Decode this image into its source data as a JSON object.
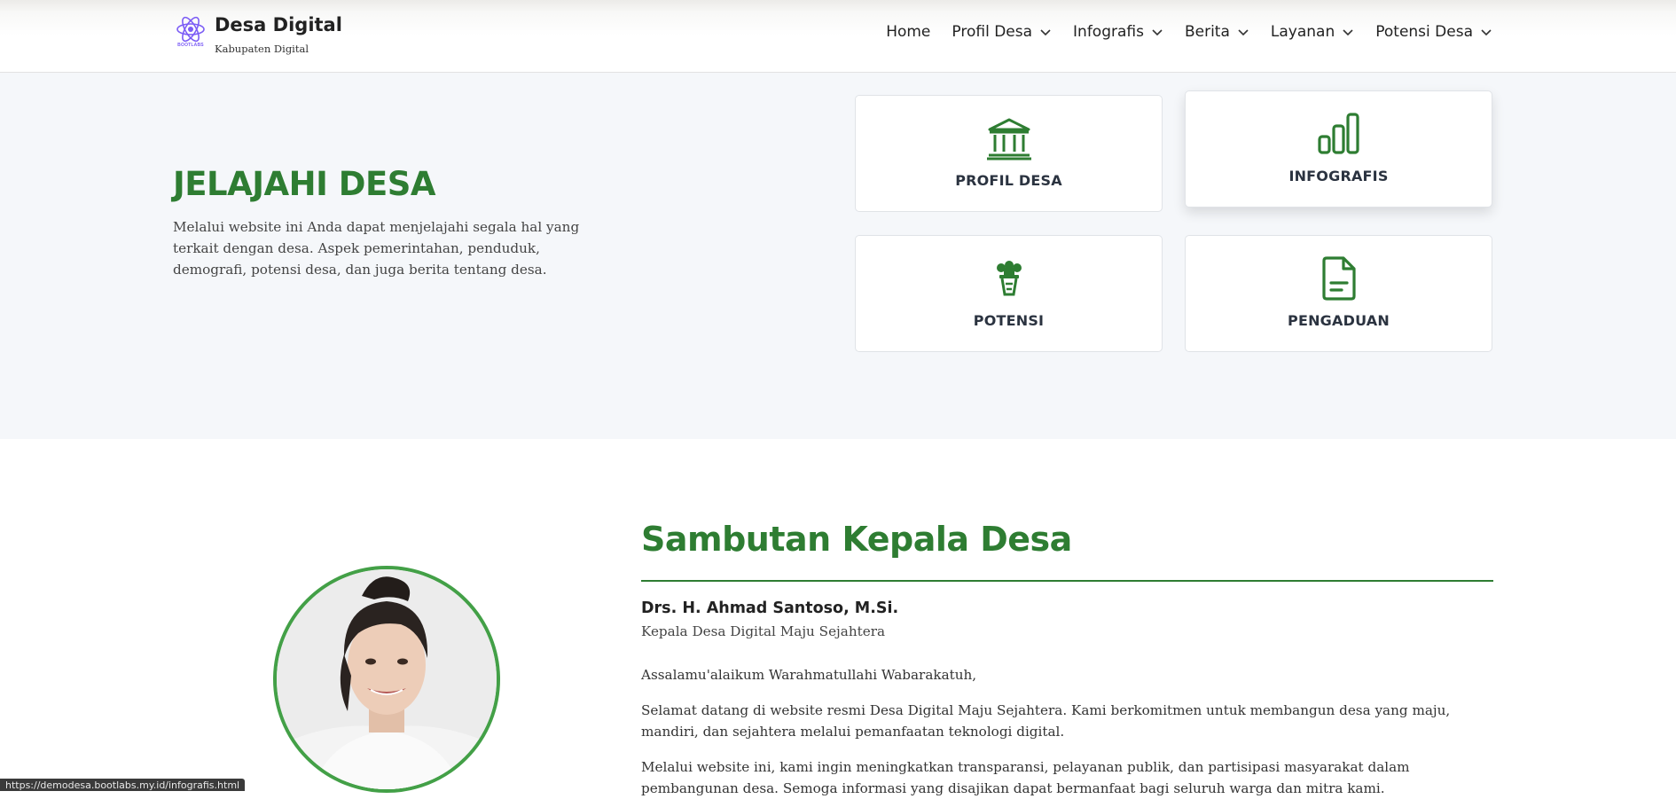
{
  "brand": {
    "title": "Desa Digital",
    "subtitle": "Kabupaten Digital",
    "logo_word": "BOOTLABS",
    "logo_color": "#7b5cf5"
  },
  "nav": {
    "items": [
      {
        "label": "Home",
        "dropdown": false
      },
      {
        "label": "Profil Desa",
        "dropdown": true
      },
      {
        "label": "Infografis",
        "dropdown": true
      },
      {
        "label": "Berita",
        "dropdown": true
      },
      {
        "label": "Layanan",
        "dropdown": true
      },
      {
        "label": "Potensi Desa",
        "dropdown": true
      }
    ]
  },
  "hero": {
    "title": "JELAJAHI DESA",
    "text": "Melalui website ini Anda dapat menjelajahi segala hal yang terkait dengan desa. Aspek pemerintahan, penduduk, demografi, potensi desa, dan juga berita tentang desa.",
    "cards": [
      {
        "label": "PROFIL DESA",
        "icon": "bank-icon"
      },
      {
        "label": "INFOGRAFIS",
        "icon": "bar-chart-icon"
      },
      {
        "label": "POTENSI",
        "icon": "flower-pot-icon"
      },
      {
        "label": "PENGADUAN",
        "icon": "document-icon"
      }
    ]
  },
  "sambutan": {
    "title": "Sambutan Kepala Desa",
    "name": "Drs. H. Ahmad Santoso, M.Si.",
    "role": "Kepala Desa Digital Maju Sejahtera",
    "greeting": "Assalamu'alaikum Warahmatullahi Wabarakatuh,",
    "para1": "Selamat datang di website resmi Desa Digital Maju Sejahtera. Kami berkomitmen untuk membangun desa yang maju, mandiri, dan sejahtera melalui pemanfaatan teknologi digital.",
    "para2": "Melalui website ini, kami ingin meningkatkan transparansi, pelayanan publik, dan partisipasi masyarakat dalam pembangunan desa. Semoga informasi yang disajikan dapat bermanfaat bagi seluruh warga dan mitra kami."
  },
  "status_bar": {
    "url": "https://demodesa.bootlabs.my.id/infografis.html"
  },
  "colors": {
    "accent_green": "#2e7d32",
    "portrait_ring": "#43a047",
    "hero_bg": "#f5f7fa"
  }
}
